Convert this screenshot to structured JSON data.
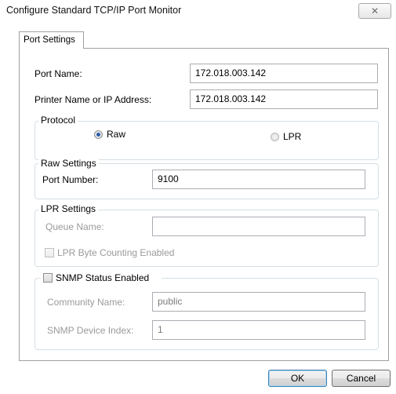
{
  "window": {
    "title": "Configure Standard TCP/IP Port Monitor",
    "close_glyph": "✕"
  },
  "tabs": [
    {
      "label": "Port Settings",
      "selected": true
    }
  ],
  "port_name": {
    "label": "Port Name:",
    "value": "172.018.003.142"
  },
  "printer_address": {
    "label": "Printer Name or IP Address:",
    "value": "172.018.003.142"
  },
  "protocol": {
    "legend": "Protocol",
    "options": [
      {
        "label": "Raw",
        "checked": true
      },
      {
        "label": "LPR",
        "checked": false
      }
    ]
  },
  "raw_settings": {
    "legend": "Raw Settings",
    "port_number_label": "Port Number:",
    "port_number_value": "9100"
  },
  "lpr_settings": {
    "legend": "LPR Settings",
    "queue_name_label": "Queue Name:",
    "queue_name_value": "",
    "byte_counting_label": "LPR Byte Counting Enabled",
    "byte_counting_checked": false
  },
  "snmp": {
    "enabled_label": "SNMP Status Enabled",
    "enabled_checked": false,
    "community_label": "Community Name:",
    "community_value": "public",
    "device_index_label": "SNMP Device Index:",
    "device_index_value": "1"
  },
  "buttons": {
    "ok": "OK",
    "cancel": "Cancel"
  },
  "colors": {
    "radio_dot": "#2a5fa8",
    "disabled_text": "#9a9a9a",
    "group_border": "#d5dfe5"
  }
}
